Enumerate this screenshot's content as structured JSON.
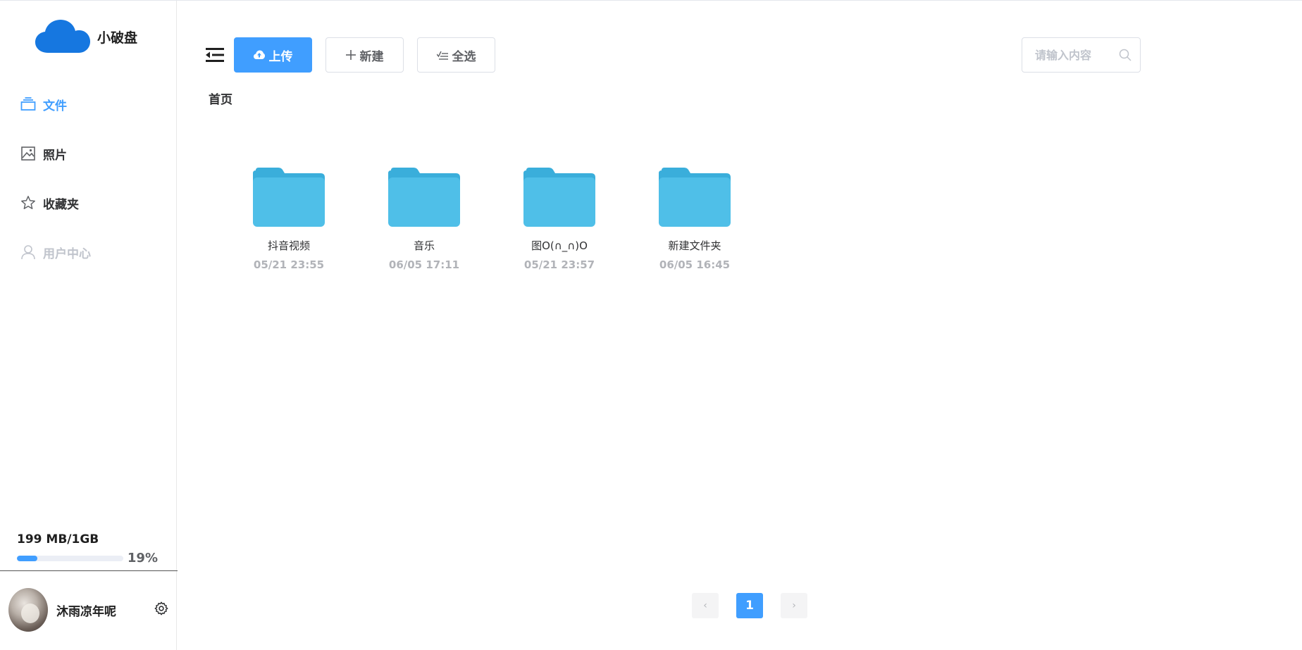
{
  "app": {
    "title": "小破盘"
  },
  "colors": {
    "accent": "#409eff",
    "folder": "#4fbfe8",
    "folder_tab": "#3aaedb"
  },
  "sidebar": {
    "items": [
      {
        "label": "文件",
        "icon": "file-stack-icon",
        "active": true
      },
      {
        "label": "照片",
        "icon": "image-icon"
      },
      {
        "label": "收藏夹",
        "icon": "star-icon"
      },
      {
        "label": "用户中心",
        "icon": "user-icon",
        "disabled": true
      }
    ],
    "storage": {
      "text": "199 MB/1GB",
      "percent_label": "19%",
      "percent": 19
    },
    "user": {
      "name": "沐雨凉年呢"
    }
  },
  "toolbar": {
    "upload_label": "上传",
    "new_label": "新建",
    "select_all_label": "全选"
  },
  "search": {
    "placeholder": "请输入内容"
  },
  "breadcrumb": {
    "root": "首页"
  },
  "files": [
    {
      "name": "抖音视频",
      "date": "05/21 23:55"
    },
    {
      "name": "音乐",
      "date": "06/05 17:11"
    },
    {
      "name": "图O(∩_∩)O",
      "date": "05/21 23:57"
    },
    {
      "name": "新建文件夹",
      "date": "06/05 16:45"
    }
  ],
  "pagination": {
    "current": "1",
    "prev": "‹",
    "next": "›"
  }
}
